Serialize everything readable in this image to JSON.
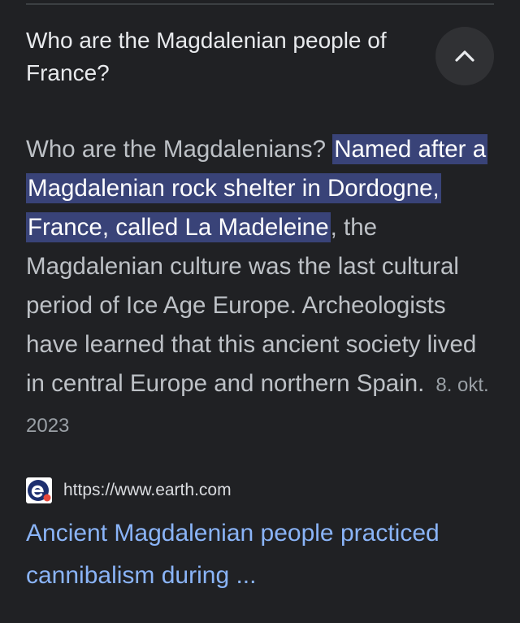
{
  "question": {
    "text": "Who are the Magdalenian people of France?"
  },
  "collapse_button": {
    "icon": "chevron-up-icon"
  },
  "answer": {
    "intro": "Who are the Magdalenians? ",
    "highlighted": "Named after a Magdalenian rock shelter in Dordogne, France, called La Madeleine",
    "rest": ", the Magdalenian culture was the last cultural period of Ice Age Europe. Archeologists have learned that this ancient society lived in central Europe and northern Spain.",
    "date": "8. okt. 2023"
  },
  "source": {
    "favicon": "earth-com-favicon",
    "url": "https://www.earth.com",
    "title": "Ancient Magdalenian people practiced cannibalism during ..."
  },
  "colors": {
    "background": "#202124",
    "highlight": "#394378",
    "link": "#8ab4f8"
  }
}
